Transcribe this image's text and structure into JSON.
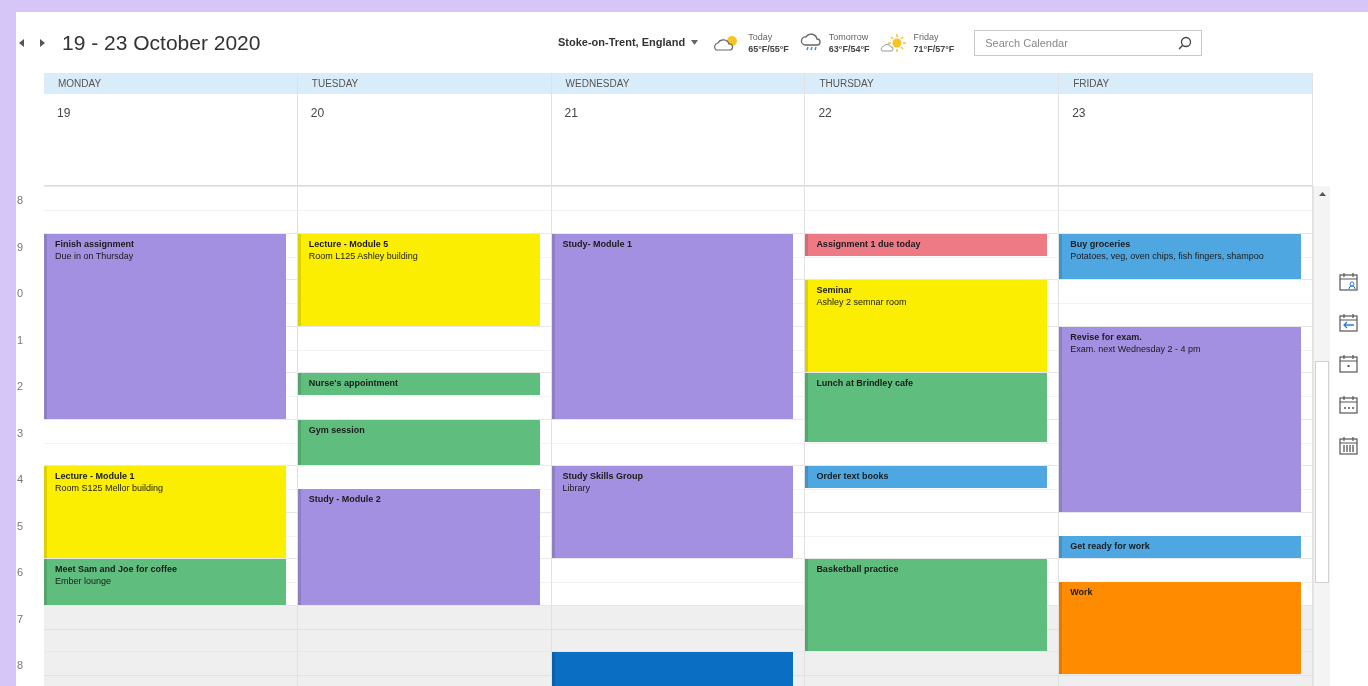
{
  "header": {
    "range": "19 - 23 October 2020",
    "location": "Stoke-on-Trent, England",
    "weather": [
      {
        "day": "Today",
        "temps": "65°F/55°F",
        "kind": "partly_cloudy"
      },
      {
        "day": "Tomorrow",
        "temps": "63°F/54°F",
        "kind": "rain"
      },
      {
        "day": "Friday",
        "temps": "71°F/57°F",
        "kind": "sunny"
      }
    ],
    "search": {
      "placeholder": "Search Calendar"
    }
  },
  "hours": [
    {
      "label": "8",
      "shaded": false
    },
    {
      "label": "9",
      "shaded": false
    },
    {
      "label": "0",
      "shaded": false
    },
    {
      "label": "1",
      "shaded": false
    },
    {
      "label": "2",
      "shaded": false
    },
    {
      "label": "3",
      "shaded": false
    },
    {
      "label": "4",
      "shaded": false
    },
    {
      "label": "5",
      "shaded": false
    },
    {
      "label": "6",
      "shaded": false
    },
    {
      "label": "7",
      "shaded": true
    },
    {
      "label": "8",
      "shaded": true
    }
  ],
  "days": [
    {
      "name": "MONDAY",
      "date": "19",
      "slots": [
        {
          "kind": "free"
        },
        {
          "kind": "free"
        },
        {
          "kind": "start",
          "title": "Finish assignment",
          "note": "Due in on Thursday",
          "color": "#a390e0"
        },
        {
          "kind": "cont"
        },
        {
          "kind": "cont"
        },
        {
          "kind": "cont"
        },
        {
          "kind": "cont"
        },
        {
          "kind": "cont"
        },
        {
          "kind": "cont"
        },
        {
          "kind": "cont"
        },
        {
          "kind": "free"
        },
        {
          "kind": "free"
        },
        {
          "kind": "start",
          "title": "Lecture - Module 1",
          "note": "Room S125 Mellor building",
          "color": "#fcee00"
        },
        {
          "kind": "cont"
        },
        {
          "kind": "cont"
        },
        {
          "kind": "cont"
        },
        {
          "kind": "start",
          "title": "Meet Sam and Joe for coffee",
          "note": "Ember lounge",
          "color": "#5fbe7d"
        },
        {
          "kind": "cont"
        },
        {
          "kind": "free"
        },
        {
          "kind": "free"
        },
        {
          "kind": "free"
        },
        {
          "kind": "free"
        }
      ]
    },
    {
      "name": "TUESDAY",
      "date": "20",
      "slots": [
        {
          "kind": "free"
        },
        {
          "kind": "free"
        },
        {
          "kind": "start",
          "title": "Lecture - Module 5",
          "note": "Room L125 Ashley building",
          "color": "#fcee00"
        },
        {
          "kind": "cont"
        },
        {
          "kind": "cont"
        },
        {
          "kind": "cont"
        },
        {
          "kind": "free"
        },
        {
          "kind": "free"
        },
        {
          "kind": "start",
          "title": "Nurse's appointment",
          "color": "#5fbe7d"
        },
        {
          "kind": "free"
        },
        {
          "kind": "start",
          "title": "Gym session",
          "color": "#5fbe7d"
        },
        {
          "kind": "cont"
        },
        {
          "kind": "free"
        },
        {
          "kind": "start",
          "title": "Study - Module 2",
          "color": "#a390e0"
        },
        {
          "kind": "cont"
        },
        {
          "kind": "cont"
        },
        {
          "kind": "cont"
        },
        {
          "kind": "cont"
        },
        {
          "kind": "free"
        },
        {
          "kind": "free"
        },
        {
          "kind": "free"
        },
        {
          "kind": "free"
        }
      ]
    },
    {
      "name": "WEDNESDAY",
      "date": "21",
      "slots": [
        {
          "kind": "free"
        },
        {
          "kind": "free"
        },
        {
          "kind": "start",
          "title": "Study- Module 1",
          "color": "#a390e0"
        },
        {
          "kind": "cont"
        },
        {
          "kind": "cont"
        },
        {
          "kind": "cont"
        },
        {
          "kind": "cont"
        },
        {
          "kind": "cont"
        },
        {
          "kind": "cont"
        },
        {
          "kind": "cont"
        },
        {
          "kind": "free"
        },
        {
          "kind": "free"
        },
        {
          "kind": "start",
          "title": "Study Skills Group",
          "note": "Library",
          "color": "#a390e0"
        },
        {
          "kind": "cont"
        },
        {
          "kind": "cont"
        },
        {
          "kind": "cont"
        },
        {
          "kind": "free"
        },
        {
          "kind": "free"
        },
        {
          "kind": "free"
        },
        {
          "kind": "free"
        },
        {
          "kind": "start",
          "color": "#0a6fc2"
        },
        {
          "kind": "cont"
        }
      ]
    },
    {
      "name": "THURSDAY",
      "date": "22",
      "slots": [
        {
          "kind": "free"
        },
        {
          "kind": "free"
        },
        {
          "kind": "start",
          "title": "Assignment 1 due today",
          "color": "#ee7a86"
        },
        {
          "kind": "free"
        },
        {
          "kind": "start",
          "title": "Seminar",
          "note": "Ashley 2 semnar room",
          "color": "#fcee00"
        },
        {
          "kind": "cont"
        },
        {
          "kind": "cont"
        },
        {
          "kind": "cont"
        },
        {
          "kind": "start",
          "title": "Lunch at Brindley cafe",
          "color": "#5fbe7d"
        },
        {
          "kind": "cont"
        },
        {
          "kind": "cont"
        },
        {
          "kind": "free"
        },
        {
          "kind": "start",
          "title": "Order text books",
          "color": "#4fa7e2"
        },
        {
          "kind": "free"
        },
        {
          "kind": "free"
        },
        {
          "kind": "free"
        },
        {
          "kind": "start",
          "title": "Basketball practice",
          "color": "#5fbe7d"
        },
        {
          "kind": "cont"
        },
        {
          "kind": "cont"
        },
        {
          "kind": "cont"
        },
        {
          "kind": "free"
        },
        {
          "kind": "free"
        }
      ]
    },
    {
      "name": "FRIDAY",
      "date": "23",
      "slots": [
        {
          "kind": "free"
        },
        {
          "kind": "free"
        },
        {
          "kind": "start",
          "title": "Buy groceries",
          "note": "Potatoes, veg, oven chips, fish fingers, shampoo",
          "color": "#4fa7e2"
        },
        {
          "kind": "cont"
        },
        {
          "kind": "free"
        },
        {
          "kind": "free"
        },
        {
          "kind": "start",
          "title": "Revise for exam.",
          "note": "Exam. next Wednesday 2 - 4 pm",
          "color": "#a390e0"
        },
        {
          "kind": "cont"
        },
        {
          "kind": "cont"
        },
        {
          "kind": "cont"
        },
        {
          "kind": "cont"
        },
        {
          "kind": "cont"
        },
        {
          "kind": "cont"
        },
        {
          "kind": "cont"
        },
        {
          "kind": "free"
        },
        {
          "kind": "start",
          "title": "Get ready for work",
          "color": "#4fa7e2"
        },
        {
          "kind": "free"
        },
        {
          "kind": "start",
          "title": "Work",
          "color": "#ff8c00"
        },
        {
          "kind": "cont"
        },
        {
          "kind": "cont"
        },
        {
          "kind": "cont"
        },
        {
          "kind": "free"
        }
      ]
    }
  ]
}
